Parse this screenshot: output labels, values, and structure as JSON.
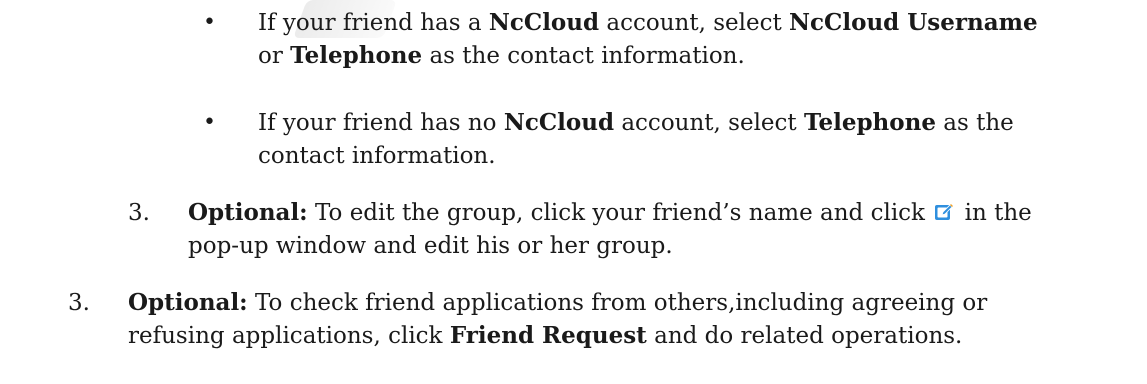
{
  "document": {
    "sub_bullets": [
      {
        "line1": {
          "t1": "If your friend has a ",
          "b1": "NcCloud",
          "t2": " account, select ",
          "b2": "NcCloud Username"
        },
        "line2": {
          "t1": "or ",
          "b1": "Telephone",
          "t2": " as the contact information."
        }
      },
      {
        "line1": {
          "t1": "If your friend has no ",
          "b1": "NcCloud",
          "t2": " account, select ",
          "b2": "Telephone",
          "t3": " as the"
        },
        "line2": {
          "t1": "contact information."
        }
      }
    ],
    "bullet_glyph": "•",
    "step3_inner": {
      "number": "3.",
      "label": "Optional:",
      "line1_text": " To edit the group, click your friend’s name and click ",
      "line1_tail": " in the",
      "line2": "pop-up window and edit his or her group.",
      "icon": "edit-icon"
    },
    "step3_outer": {
      "number": "3.",
      "label": "Optional:",
      "line1_text": " To check friend applications from others,including agreeing or",
      "line2_t1": "refusing applications, click ",
      "line2_b1": "Friend Request",
      "line2_t2": " and do related operations."
    },
    "colors": {
      "text": "#1a1a1a",
      "icon_blue": "#2f8fde",
      "icon_accent": "#f1a32a"
    }
  }
}
